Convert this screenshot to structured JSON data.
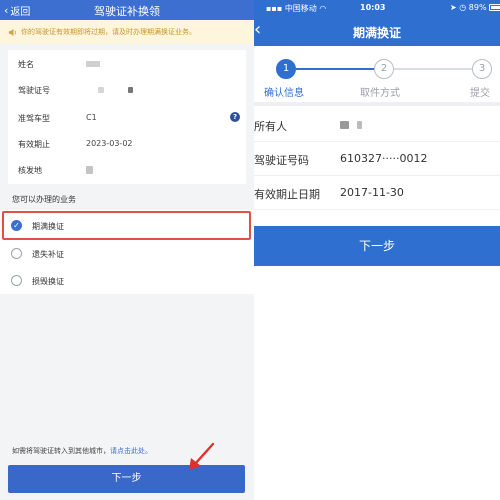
{
  "left": {
    "nav": {
      "back_label": "返回",
      "title": "驾驶证补换领"
    },
    "notice": "你的驾驶证有效期即将过期，请及时办理期满换证业务。",
    "info_rows": [
      {
        "label": "姓名",
        "value": ""
      },
      {
        "label": "驾驶证号",
        "value": ""
      },
      {
        "label": "准驾车型",
        "value": "C1"
      },
      {
        "label": "有效期止",
        "value": "2023-03-02"
      },
      {
        "label": "核发地",
        "value": ""
      }
    ],
    "help_icon": "?",
    "section_title": "您可以办理的业务",
    "options": [
      {
        "label": "期满换证",
        "selected": true
      },
      {
        "label": "遗失补证",
        "selected": false
      },
      {
        "label": "损毁换证",
        "selected": false
      }
    ],
    "footer_text": "如需将驾驶证转入到其他城市，",
    "footer_link": "请点击此处。",
    "next_button": "下一步",
    "colors": {
      "primary": "#3d6fd0",
      "highlight": "#e05048",
      "notice_bg": "#fdf6dc"
    }
  },
  "right": {
    "status": {
      "carrier": "中国移动",
      "time": "10:03",
      "battery": "89%"
    },
    "nav": {
      "back_icon": "chevron-left-icon",
      "title": "期满换证"
    },
    "steps": [
      {
        "num": "1",
        "label": "确认信息",
        "active": true
      },
      {
        "num": "2",
        "label": "取件方式",
        "active": false
      },
      {
        "num": "3",
        "label": "提交",
        "active": false
      }
    ],
    "rows": [
      {
        "label": "所有人",
        "value": ""
      },
      {
        "label": "驾驶证号码",
        "value": "610327·····0012"
      },
      {
        "label": "有效期止日期",
        "value": "2017-11-30"
      }
    ],
    "next_button": "下一步",
    "colors": {
      "primary": "#2f6fd0"
    }
  }
}
